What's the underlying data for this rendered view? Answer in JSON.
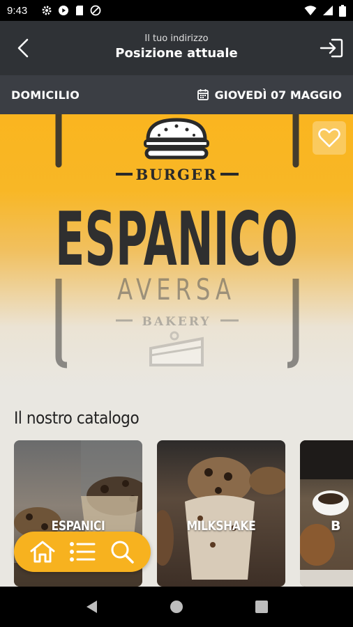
{
  "status_bar": {
    "time": "9:43"
  },
  "header": {
    "subtitle": "Il tuo indirizzo",
    "title": "Posizione attuale"
  },
  "sub_bar": {
    "mode": "DOMICILIO",
    "date": "GIOVEDÌ 07 MAGGIO"
  },
  "hero": {
    "logo_text": {
      "top": "BURGER",
      "main": "ESPANICO",
      "city": "AVERSA",
      "bottom": "BAKERY"
    }
  },
  "catalog": {
    "title": "Il nostro catalogo",
    "items": [
      {
        "label": "ESPANICI"
      },
      {
        "label": "MILKSHAKE"
      },
      {
        "label": "B"
      }
    ]
  },
  "colors": {
    "accent": "#f7b21f",
    "header_bg": "#2f3236",
    "subbar_bg": "#3b3e44"
  },
  "icons": {
    "back": "chevron-left-icon",
    "login": "login-icon",
    "calendar": "calendar-icon",
    "favorite": "heart-icon",
    "home": "home-icon",
    "list": "list-icon",
    "search": "search-icon"
  }
}
